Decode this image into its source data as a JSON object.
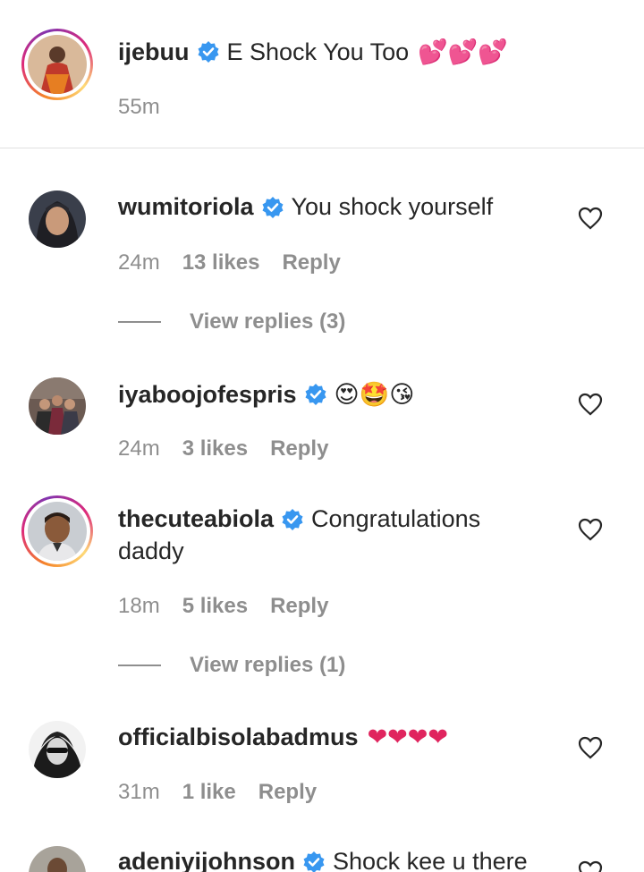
{
  "caption": {
    "username": "ijebuu",
    "text": "E Shock You Too",
    "emoji": "💕💕💕",
    "time": "55m"
  },
  "comments": [
    {
      "username": "wumitoriola",
      "text": "You shock yourself",
      "time": "24m",
      "likes": "13 likes",
      "reply": "Reply",
      "view_replies": "View replies (3)"
    },
    {
      "username": "iyaboojofespris",
      "text": "😍🤩😘",
      "time": "24m",
      "likes": "3 likes",
      "reply": "Reply"
    },
    {
      "username": "thecuteabiola",
      "text_line1": "Congratulations",
      "text_line2": "daddy",
      "time": "18m",
      "likes": "5 likes",
      "reply": "Reply",
      "view_replies": "View replies (1)"
    },
    {
      "username": "officialbisolabadmus",
      "text": "❤❤❤❤",
      "time": "31m",
      "likes": "1 like",
      "reply": "Reply"
    },
    {
      "username": "adeniyijohnson",
      "text": "Shock kee u there"
    }
  ],
  "icons": {
    "verified": "verified-badge-icon",
    "like": "heart-outline-icon"
  },
  "colors": {
    "verified": "#3897f0",
    "muted": "#8e8e8e",
    "text": "#262626",
    "heart_emoji": "#e0245e"
  }
}
